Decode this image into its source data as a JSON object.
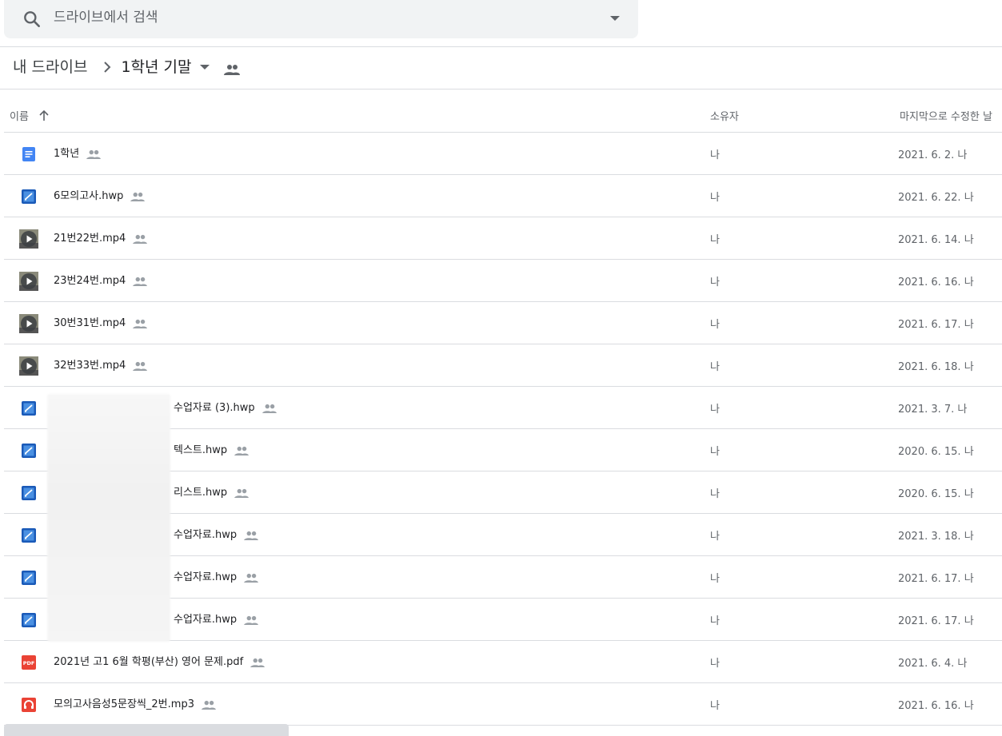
{
  "search": {
    "placeholder": "드라이브에서 검색"
  },
  "breadcrumb": {
    "root": "내 드라이브",
    "current": "1학년 기말"
  },
  "header": {
    "name": "이름",
    "owner": "소유자",
    "modified": "마지막으로 수정한 날"
  },
  "files": [
    {
      "type": "doc",
      "name": "1학년",
      "owner": "나",
      "modified": "2021. 6. 2. 나"
    },
    {
      "type": "hwp",
      "name": "6모의고사.hwp",
      "owner": "나",
      "modified": "2021. 6. 22. 나"
    },
    {
      "type": "video",
      "name": "21번22번.mp4",
      "owner": "나",
      "modified": "2021. 6. 14. 나"
    },
    {
      "type": "video",
      "name": "23번24번.mp4",
      "owner": "나",
      "modified": "2021. 6. 16. 나"
    },
    {
      "type": "video",
      "name": "30번31번.mp4",
      "owner": "나",
      "modified": "2021. 6. 17. 나"
    },
    {
      "type": "video",
      "name": "32번33번.mp4",
      "owner": "나",
      "modified": "2021. 6. 18. 나"
    },
    {
      "type": "hwp",
      "name": "수업자료 (3).hwp",
      "owner": "나",
      "modified": "2021. 3. 7. 나",
      "pad": 150
    },
    {
      "type": "hwp",
      "name": "텍스트.hwp",
      "owner": "나",
      "modified": "2020. 6. 15. 나",
      "pad": 150
    },
    {
      "type": "hwp",
      "name": "리스트.hwp",
      "owner": "나",
      "modified": "2020. 6. 15. 나",
      "pad": 150
    },
    {
      "type": "hwp",
      "name": "수업자료.hwp",
      "owner": "나",
      "modified": "2021. 3. 18. 나",
      "pad": 150
    },
    {
      "type": "hwp",
      "name": "수업자료.hwp",
      "owner": "나",
      "modified": "2021. 6. 17. 나",
      "pad": 150
    },
    {
      "type": "hwp",
      "name": "수업자료.hwp",
      "owner": "나",
      "modified": "2021. 6. 17. 나",
      "pad": 150
    },
    {
      "type": "pdf",
      "name": "2021년 고1 6월 학평(부산) 영어 문제.pdf",
      "owner": "나",
      "modified": "2021. 6. 4. 나"
    },
    {
      "type": "audio",
      "name": "모의고사음성5문장씩_2번.mp3",
      "owner": "나",
      "modified": "2021. 6. 16. 나"
    }
  ],
  "colors": {
    "doc": "#4285f4",
    "hwp": "#1a73e8",
    "pdf": "#ea4335",
    "audio": "#ea4335",
    "video": "#5f6368"
  }
}
